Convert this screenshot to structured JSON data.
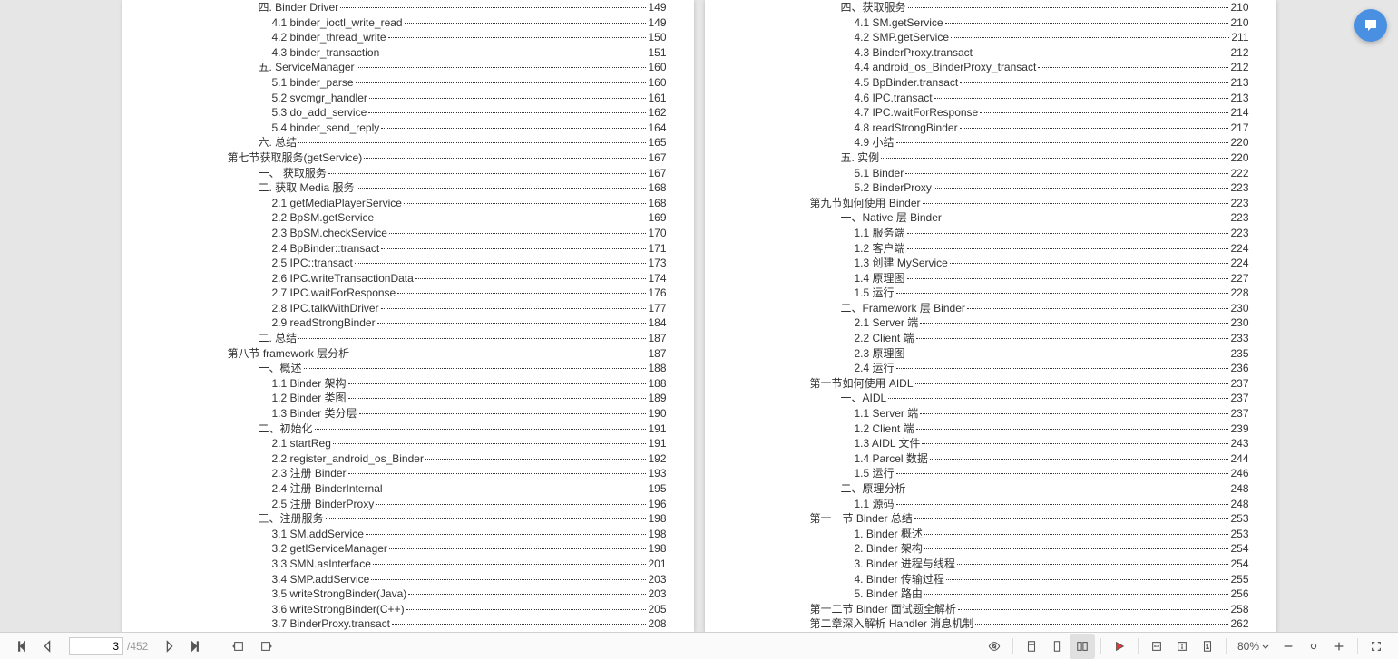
{
  "nav": {
    "current_page": "3",
    "total_pages": "/452",
    "zoom": "80%"
  },
  "left_page": [
    {
      "ind": 2,
      "text": "四. Binder Driver",
      "page": "149"
    },
    {
      "ind": 3,
      "text": "4.1 binder_ioctl_write_read",
      "page": "149"
    },
    {
      "ind": 3,
      "text": "4.2 binder_thread_write",
      "page": "150"
    },
    {
      "ind": 3,
      "text": "4.3 binder_transaction",
      "page": "151"
    },
    {
      "ind": 2,
      "text": "五. ServiceManager",
      "page": "160"
    },
    {
      "ind": 3,
      "text": "5.1 binder_parse",
      "page": "160"
    },
    {
      "ind": 3,
      "text": "5.2 svcmgr_handler",
      "page": "161"
    },
    {
      "ind": 3,
      "text": "5.3 do_add_service",
      "page": "162"
    },
    {
      "ind": 3,
      "text": "5.4 binder_send_reply",
      "page": "164"
    },
    {
      "ind": 2,
      "text": "六. 总结",
      "page": "165"
    },
    {
      "ind": 0,
      "text": "第七节获取服务(getService)",
      "page": "167"
    },
    {
      "ind": 2,
      "text": "一、 获取服务",
      "page": "167"
    },
    {
      "ind": 2,
      "text": "二. 获取 Media 服务",
      "page": "168"
    },
    {
      "ind": 3,
      "text": "2.1 getMediaPlayerService",
      "page": "168"
    },
    {
      "ind": 3,
      "text": "2.2 BpSM.getService",
      "page": "169"
    },
    {
      "ind": 3,
      "text": "2.3 BpSM.checkService",
      "page": "170"
    },
    {
      "ind": 3,
      "text": "2.4 BpBinder::transact",
      "page": "171"
    },
    {
      "ind": 3,
      "text": "2.5 IPC::transact",
      "page": "173"
    },
    {
      "ind": 3,
      "text": "2.6 IPC.writeTransactionData",
      "page": "174"
    },
    {
      "ind": 3,
      "text": "2.7 IPC.waitForResponse",
      "page": "176"
    },
    {
      "ind": 3,
      "text": "2.8 IPC.talkWithDriver",
      "page": "177"
    },
    {
      "ind": 3,
      "text": "2.9 readStrongBinder",
      "page": "184"
    },
    {
      "ind": 2,
      "text": "二. 总结",
      "page": "187"
    },
    {
      "ind": 0,
      "text": "第八节 framework 层分析",
      "page": "187"
    },
    {
      "ind": 2,
      "text": "一、概述",
      "page": "188"
    },
    {
      "ind": 3,
      "text": "1.1 Binder 架构",
      "page": "188"
    },
    {
      "ind": 3,
      "text": "1.2 Binder 类图",
      "page": "189"
    },
    {
      "ind": 3,
      "text": "1.3 Binder 类分层",
      "page": "190"
    },
    {
      "ind": 2,
      "text": "二、初始化",
      "page": "191"
    },
    {
      "ind": 3,
      "text": "2.1 startReg",
      "page": "191"
    },
    {
      "ind": 3,
      "text": "2.2 register_android_os_Binder",
      "page": "192"
    },
    {
      "ind": 3,
      "text": "2.3 注册 Binder",
      "page": "193"
    },
    {
      "ind": 3,
      "text": "2.4 注册 BinderInternal",
      "page": "195"
    },
    {
      "ind": 3,
      "text": "2.5 注册 BinderProxy",
      "page": "196"
    },
    {
      "ind": 2,
      "text": "三、注册服务",
      "page": "198"
    },
    {
      "ind": 3,
      "text": "3.1 SM.addService",
      "page": "198"
    },
    {
      "ind": 3,
      "text": "3.2 getIServiceManager",
      "page": "198"
    },
    {
      "ind": 3,
      "text": "3.3 SMN.asInterface",
      "page": "201"
    },
    {
      "ind": 3,
      "text": "3.4 SMP.addService",
      "page": "203"
    },
    {
      "ind": 3,
      "text": "3.5 writeStrongBinder(Java)",
      "page": "203"
    },
    {
      "ind": 3,
      "text": "3.6 writeStrongBinder(C++)",
      "page": "205"
    },
    {
      "ind": 3,
      "text": "3.7 BinderProxy.transact",
      "page": "208"
    }
  ],
  "right_page": [
    {
      "ind": 2,
      "text": "四、获取服务",
      "page": "210"
    },
    {
      "ind": 3,
      "text": "4.1 SM.getService",
      "page": "210"
    },
    {
      "ind": 3,
      "text": "4.2 SMP.getService",
      "page": "211"
    },
    {
      "ind": 3,
      "text": "4.3 BinderProxy.transact",
      "page": "212"
    },
    {
      "ind": 3,
      "text": "4.4 android_os_BinderProxy_transact",
      "page": "212"
    },
    {
      "ind": 3,
      "text": "4.5 BpBinder.transact",
      "page": "213"
    },
    {
      "ind": 3,
      "text": "4.6 IPC.transact",
      "page": "213"
    },
    {
      "ind": 3,
      "text": "4.7 IPC.waitForResponse",
      "page": "214"
    },
    {
      "ind": 3,
      "text": "4.8 readStrongBinder",
      "page": "217"
    },
    {
      "ind": 3,
      "text": "4.9 小结",
      "page": "220"
    },
    {
      "ind": 2,
      "text": "五. 实例",
      "page": "220"
    },
    {
      "ind": 3,
      "text": "5.1 Binder",
      "page": "222"
    },
    {
      "ind": 3,
      "text": "5.2 BinderProxy",
      "page": "223"
    },
    {
      "ind": 0,
      "text": "第九节如何使用 Binder",
      "page": "223"
    },
    {
      "ind": 2,
      "text": "一、Native 层 Binder",
      "page": "223"
    },
    {
      "ind": 3,
      "text": "1.1 服务端",
      "page": "223"
    },
    {
      "ind": 3,
      "text": "1.2 客户端",
      "page": "224"
    },
    {
      "ind": 3,
      "text": "1.3 创建 MyService",
      "page": "224"
    },
    {
      "ind": 3,
      "text": "1.4 原理图",
      "page": "227"
    },
    {
      "ind": 3,
      "text": "1.5 运行",
      "page": "228"
    },
    {
      "ind": 2,
      "text": "二、Framework 层 Binder",
      "page": "230"
    },
    {
      "ind": 3,
      "text": "2.1 Server 端",
      "page": "230"
    },
    {
      "ind": 3,
      "text": "2.2 Client 端",
      "page": "233"
    },
    {
      "ind": 3,
      "text": "2.3 原理图",
      "page": "235"
    },
    {
      "ind": 3,
      "text": "2.4 运行",
      "page": "236"
    },
    {
      "ind": 0,
      "text": "第十节如何使用 AIDL",
      "page": "237"
    },
    {
      "ind": 2,
      "text": "一、AIDL",
      "page": "237"
    },
    {
      "ind": 3,
      "text": "1.1 Server 端",
      "page": "237"
    },
    {
      "ind": 3,
      "text": "1.2 Client 端",
      "page": "239"
    },
    {
      "ind": 3,
      "text": "1.3 AIDL 文件",
      "page": "243"
    },
    {
      "ind": 3,
      "text": "1.4 Parcel 数据",
      "page": "244"
    },
    {
      "ind": 3,
      "text": "1.5 运行",
      "page": "246"
    },
    {
      "ind": 2,
      "text": "二、原理分析",
      "page": "248"
    },
    {
      "ind": 3,
      "text": "1.1 源码",
      "page": "248"
    },
    {
      "ind": 0,
      "text": "第十一节 Binder 总结",
      "page": "253"
    },
    {
      "ind": 3,
      "text": "1. Binder 概述",
      "page": "253"
    },
    {
      "ind": 3,
      "text": "2. Binder 架构",
      "page": "254"
    },
    {
      "ind": 3,
      "text": "3. Binder 进程与线程",
      "page": "254"
    },
    {
      "ind": 3,
      "text": "4. Binder 传输过程",
      "page": "255"
    },
    {
      "ind": 3,
      "text": "5. Binder 路由",
      "page": "256"
    },
    {
      "ind": 0,
      "text": "第十二节 Binder 面试题全解析",
      "page": "258"
    },
    {
      "ind": 0,
      "text": "第二章深入解析 Handler 消息机制",
      "page": "262"
    }
  ]
}
